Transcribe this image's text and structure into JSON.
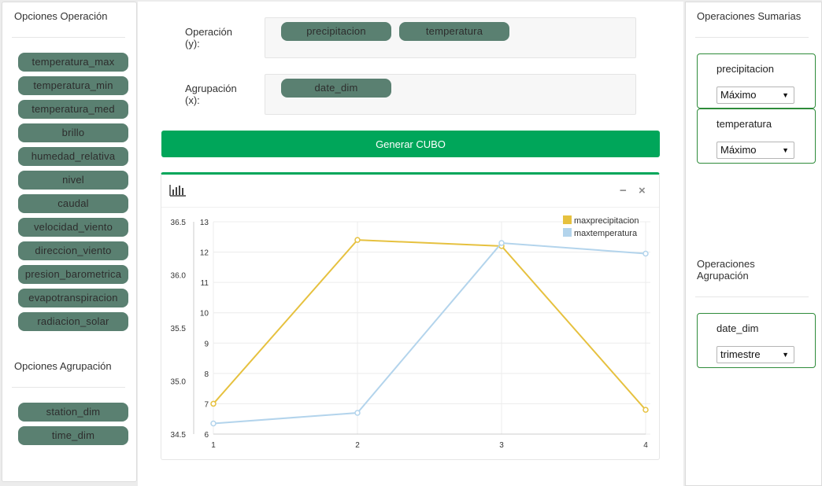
{
  "left": {
    "operation_title": "Opciones Operación",
    "operation_items": [
      "temperatura_max",
      "temperatura_min",
      "temperatura_med",
      "brillo",
      "humedad_relativa",
      "nivel",
      "caudal",
      "velocidad_viento",
      "direccion_viento",
      "presion_barometrica",
      "evapotranspiracion",
      "radiacion_solar"
    ],
    "grouping_title": "Opciones Agrupación",
    "grouping_items": [
      "station_dim",
      "time_dim"
    ]
  },
  "center": {
    "operation_label_line1": "Operación",
    "operation_label_line2": "(y):",
    "operation_pills": [
      "precipitacion",
      "temperatura"
    ],
    "grouping_label_line1": "Agrupación",
    "grouping_label_line2": "(x):",
    "grouping_pills": [
      "date_dim"
    ],
    "generate_label": "Generar CUBO"
  },
  "right": {
    "summary_title": "Operaciones Sumarias",
    "summary_items": [
      {
        "name": "precipitacion",
        "selected": "Máximo"
      },
      {
        "name": "temperatura",
        "selected": "Máximo"
      }
    ],
    "grouping_title_line1": "Operaciones",
    "grouping_title_line2": "Agrupación",
    "grouping_items": [
      {
        "name": "date_dim",
        "selected": "trimestre"
      }
    ]
  },
  "chart_data": {
    "type": "line",
    "x": [
      1,
      2,
      3,
      4
    ],
    "series": [
      {
        "name": "maxprecipitacion",
        "color": "#e6c13f",
        "values": [
          7.0,
          12.4,
          12.2,
          6.8
        ],
        "axis": "left-inner"
      },
      {
        "name": "maxtemperatura",
        "color": "#b3d4ec",
        "values": [
          34.6,
          34.7,
          36.3,
          36.2
        ],
        "axis": "left-outer"
      }
    ],
    "y_inner": {
      "min": 6,
      "max": 13,
      "ticks": [
        "6",
        "7",
        "8",
        "9",
        "10",
        "11",
        "12",
        "13"
      ]
    },
    "y_outer": {
      "min": 34.5,
      "max": 36.5,
      "ticks": [
        "34.5",
        "35.0",
        "35.5",
        "36.0",
        "36.5"
      ]
    },
    "x_ticks": [
      "1",
      "2",
      "3",
      "4"
    ],
    "grid": true,
    "legend_position": "top-right"
  },
  "colors": {
    "pill": "#5a8071",
    "accent": "#00a65a",
    "box_border": "#2e8b3a"
  }
}
